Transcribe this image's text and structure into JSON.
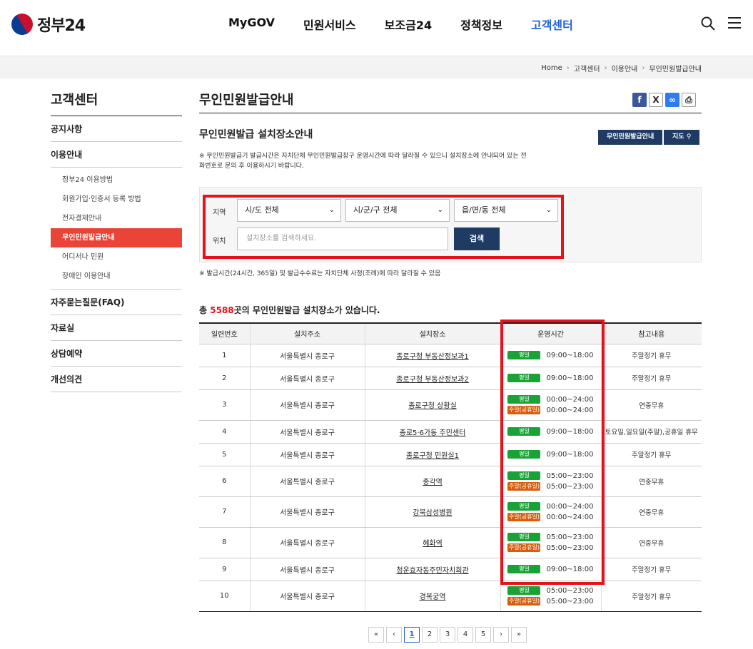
{
  "header": {
    "logo_text": "정부24",
    "nav": [
      "MyGOV",
      "민원서비스",
      "보조금24",
      "정책정보",
      "고객센터"
    ],
    "active_nav": 4
  },
  "breadcrumb": [
    "Home",
    "고객센터",
    "이용안내",
    "무인민원발급안내"
  ],
  "sidebar": {
    "title": "고객센터",
    "items": [
      {
        "label": "공지사항"
      },
      {
        "label": "이용안내"
      },
      {
        "label": "자주묻는질문(FAQ)"
      },
      {
        "label": "자료실"
      },
      {
        "label": "상담예약"
      },
      {
        "label": "개선의견"
      }
    ],
    "subitems": [
      "정부24 이용방법",
      "회원가입·인증서 등록 방법",
      "전자결제안내",
      "무인민원발급안내",
      "어디서나 민원",
      "장애인 이용안내"
    ],
    "active_sub": 3
  },
  "main": {
    "page_title": "무인민원발급안내",
    "section_title": "무인민원발급 설치장소안내",
    "btn_list": "무인민원발급안내",
    "btn_map": "지도",
    "note1": "※ 무인민원발급기 발급시간은 자치단체 무인민원발급창구 운영시간에 따라 달라질 수 있으니 설치장소에 안내되어 있는 전화번호로 문의 후 이용하시기 바랍니다.",
    "search": {
      "region_label": "지역",
      "location_label": "위치",
      "sido": "시/도 전체",
      "sigungu": "시/군/구 전체",
      "dong": "읍/면/동 전체",
      "placeholder": "설치장소를 검색하세요.",
      "button": "검색"
    },
    "note2": "※ 발급시간(24시간, 365일) 및 발급수수료는 자치단체 사정(조례)에 따라 달라질 수 있음",
    "count_prefix": "총",
    "count_num": "5588",
    "count_suffix": "곳의 무인민원발급 설치장소가 있습니다.",
    "table": {
      "headers": [
        "일련번호",
        "설치주소",
        "설치장소",
        "운영시간",
        "참고내용"
      ],
      "weekday_label": "평일",
      "weekend_label": "주말(공휴일)",
      "rows": [
        {
          "no": "1",
          "addr": "서울특별시 종로구",
          "place": "종로구청 부동산정보과1",
          "weekday": "09:00~18:00",
          "weekend": "",
          "note": "주말정기 휴무"
        },
        {
          "no": "2",
          "addr": "서울특별시 종로구",
          "place": "종로구청 부동산정보과2",
          "weekday": "09:00~18:00",
          "weekend": "",
          "note": "주말정기 휴무"
        },
        {
          "no": "3",
          "addr": "서울특별시 종로구",
          "place": "종로구청 상황실",
          "weekday": "00:00~24:00",
          "weekend": "00:00~24:00",
          "note": "연중무휴"
        },
        {
          "no": "4",
          "addr": "서울특별시 종로구",
          "place": "종로5·6가동 주민센터",
          "weekday": "09:00~18:00",
          "weekend": "",
          "note": "토요일,일요일(주말),공휴일 휴무"
        },
        {
          "no": "5",
          "addr": "서울특별시 종로구",
          "place": "종로구청 민원실1",
          "weekday": "09:00~18:00",
          "weekend": "",
          "note": "주말정기 휴무"
        },
        {
          "no": "6",
          "addr": "서울특별시 종로구",
          "place": "종각역",
          "weekday": "05:00~23:00",
          "weekend": "05:00~23:00",
          "note": "연중무휴"
        },
        {
          "no": "7",
          "addr": "서울특별시 종로구",
          "place": "강북삼성병원",
          "weekday": "00:00~24:00",
          "weekend": "00:00~24:00",
          "note": "연중무휴"
        },
        {
          "no": "8",
          "addr": "서울특별시 종로구",
          "place": "혜화역",
          "weekday": "05:00~23:00",
          "weekend": "05:00~23:00",
          "note": "연중무휴"
        },
        {
          "no": "9",
          "addr": "서울특별시 종로구",
          "place": "청운효자동주민자치회관",
          "weekday": "09:00~18:00",
          "weekend": "",
          "note": "주말정기 휴무"
        },
        {
          "no": "10",
          "addr": "서울특별시 종로구",
          "place": "경복궁역",
          "weekday": "05:00~23:00",
          "weekend": "05:00~23:00",
          "note": "주말정기 휴무"
        }
      ]
    },
    "pager": {
      "first": "«",
      "prev": "‹",
      "pages": [
        "1",
        "2",
        "3",
        "4",
        "5"
      ],
      "current": "1",
      "next": "›",
      "last": "»"
    }
  },
  "colors": {
    "accent": "#e94437",
    "navy": "#1f3b63",
    "active_nav": "#1d62d4",
    "weekday_tag": "#19a336",
    "weekend_tag": "#d85d0c",
    "highlight": "#e8101a"
  }
}
